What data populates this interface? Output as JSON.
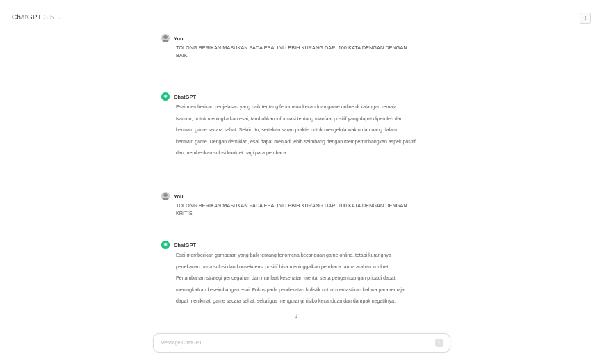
{
  "header": {
    "model_name": "ChatGPT",
    "model_version": "3.5",
    "model_chevron": "⌄",
    "share_icon": "⇩"
  },
  "messages": [
    {
      "role": "user",
      "author": "You",
      "text": "TOLONG BERIKAN MASUKAN PADA ESAI INI LEBIH KURANG DARI 100 KATA DENGAN DENGAN BAIK"
    },
    {
      "role": "assistant",
      "author": "ChatGPT",
      "text": "Esai memberikan penjelasan yang baik tentang fenomena kecanduan game online di kalangan remaja. Namun, untuk meningkatkan esai, tambahkan informasi tentang manfaat positif yang dapat diperoleh dari bermain game secara sehat. Selain itu, sertakan saran praktis untuk mengelola waktu dan uang dalam bermain game. Dengan demikian, esai dapat menjadi lebih seimbang dengan mempertimbangkan aspek positif dan memberikan solusi konkret bagi para pembaca."
    },
    {
      "role": "user",
      "author": "You",
      "text": "TOLONG BERIKAN MASUKAN PADA ESAI INI LEBIH KURANG DARI 100 KATA DENGAN DENGAN KRITIS"
    },
    {
      "role": "assistant",
      "author": "ChatGPT",
      "text": "Esai memberikan gambaran yang baik tentang fenomena kecanduan game online, tetapi kurangnya penekanan pada solusi dan konsekuensi positif bisa meninggalkan pembaca tanpa arahan konkret. Penambahan strategi pencegahan dan manfaat kesehatan mental serta pengembangan pribadi dapat meningkatkan keseimbangan esai. Fokus pada pendekatan holistik untuk memastikan bahwa para remaja dapat menikmati game secara sehat, sekaligus mengurangi risiko kecanduan dan dampak negatifnya."
    }
  ],
  "scroll_icon": "↓",
  "composer": {
    "placeholder": "Message ChatGPT…",
    "value": "",
    "send_icon": "↑"
  },
  "colors": {
    "gpt_avatar": "#19c37d",
    "send_disabled": "#e3e3e3"
  }
}
